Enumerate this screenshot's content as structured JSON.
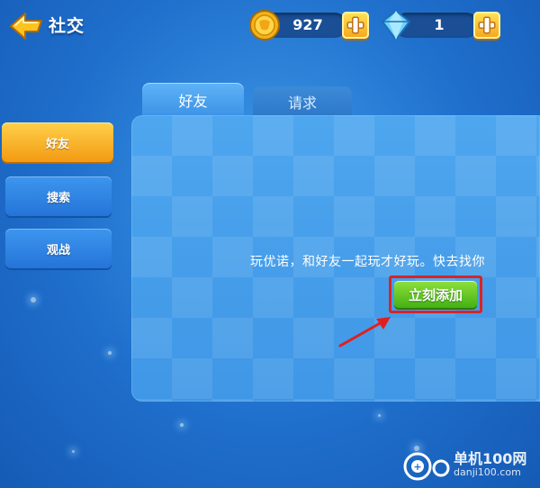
{
  "header": {
    "title": "社交",
    "back_icon": "back-arrow-icon"
  },
  "currency": {
    "coins": {
      "value": "927",
      "icon": "coin-icon"
    },
    "gems": {
      "value": "1",
      "icon": "diamond-icon"
    }
  },
  "sidebar": {
    "items": [
      {
        "label": "好友",
        "active": true
      },
      {
        "label": "搜索",
        "active": false
      },
      {
        "label": "观战",
        "active": false
      }
    ]
  },
  "tabs": [
    {
      "label": "好友",
      "active": true
    },
    {
      "label": "请求",
      "active": false
    }
  ],
  "panel": {
    "message": "玩优诺，和好友一起玩才好玩。快去找你",
    "add_button_label": "立刻添加"
  },
  "watermark": {
    "line1": "单机100网",
    "line2": "danji100.com"
  },
  "colors": {
    "background": "#1f6fcc",
    "active_tab": "#f39a12",
    "add_button": "#43b114",
    "highlight": "#d92424"
  }
}
